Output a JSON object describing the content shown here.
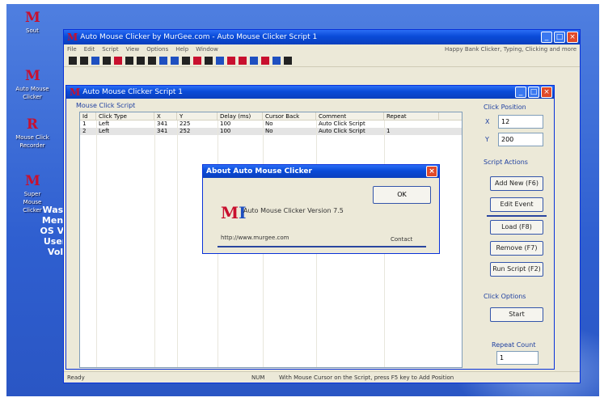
{
  "desktop": {
    "icons": [
      {
        "glyph": "M",
        "label": "Sout"
      },
      {
        "glyph": "M",
        "label": "Auto Mouse Clicker"
      },
      {
        "glyph": "R",
        "label": "Mouse Click Recorder"
      },
      {
        "glyph": "M",
        "label": "Super Mouse Clicker"
      }
    ],
    "text_lines": [
      "Wash",
      "Menu",
      "OS Ve",
      "Useri",
      "Volu"
    ]
  },
  "main_window": {
    "title": "Auto Mouse Clicker by MurGee.com - Auto Mouse Clicker Script 1",
    "menu": [
      "File",
      "Edit",
      "Script",
      "View",
      "Options",
      "Help",
      "Window"
    ],
    "menu_right": "Happy Bank Clicker, Typing, Clicking and more"
  },
  "inner_window": {
    "title": "Auto Mouse Clicker Script 1",
    "group_label": "Mouse Click Script",
    "columns": [
      "Id",
      "Click Type",
      "X",
      "Y",
      "Delay (ms)",
      "Cursor Back",
      "Comment",
      "Repeat"
    ],
    "rows": [
      [
        "1",
        "Left",
        "341",
        "225",
        "100",
        "No",
        "Auto Click Script",
        ""
      ],
      [
        "2",
        "Left",
        "341",
        "252",
        "100",
        "No",
        "Auto Click Script",
        "1"
      ]
    ]
  },
  "side_panel": {
    "add_label": "Click Position",
    "x_label": "X",
    "x_value": "12",
    "y_label": "Y",
    "y_value": "200",
    "actions_label": "Script Actions",
    "buttons": [
      "Add New (F6)",
      "Edit Event",
      "Load (F8)",
      "Remove (F7)",
      "Run Script (F2)"
    ],
    "start_label": "Click Options",
    "start_button": "Start",
    "repeat_label": "Repeat Count",
    "repeat_value": "1"
  },
  "status_bar": {
    "left": "Ready",
    "mid": "NUM",
    "right": "With Mouse Cursor on the Script, press F5 key to Add Position"
  },
  "dialog": {
    "title": "About Auto Mouse Clicker",
    "logo_a": "M",
    "logo_b": "I",
    "message": "Auto Mouse Clicker Version 7.5",
    "ok_button": "OK",
    "link": "http://www.murgee.com",
    "link2": "Contact"
  },
  "colors": {
    "titlebar": "#0a4bd8",
    "brand_red": "#c8102e",
    "desktop": "#3a68d6"
  }
}
